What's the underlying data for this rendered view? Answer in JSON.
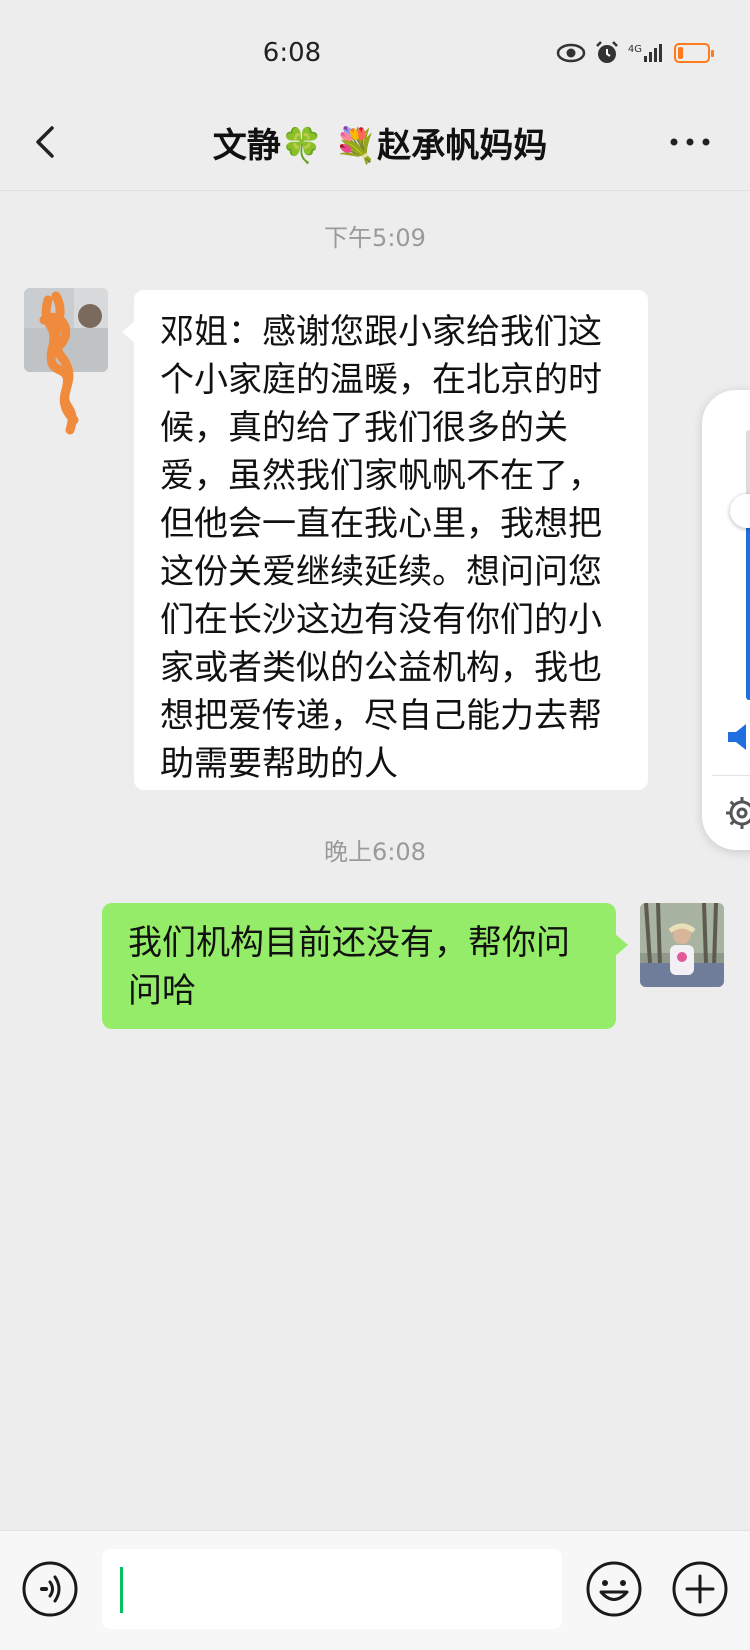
{
  "status_bar": {
    "time": "6:08",
    "network": "4G",
    "battery_level": 0.2,
    "colors": {
      "battery_low": "#ff7a1a"
    }
  },
  "header": {
    "title": "文静🍀 💐赵承帆妈妈",
    "back_icon": "chevron-left-icon",
    "more_icon": "more-dots-icon"
  },
  "messages": [
    {
      "timestamp": "下午5:09",
      "direction": "incoming",
      "lines": [
        "邓姐：感谢您跟小家给我们这",
        "个小家庭的温暖，在北京的时",
        "候，真的给了我们很多的关",
        "爱，虽然我们家帆帆不在了，",
        "但他会一直在我心里，我想把",
        "这份关爱继续延续。想问问您",
        "们在长沙这边有没有你们的小",
        "家或者类似的公益机构，我也",
        "想把爱传递，尽自己能力去帮",
        "助需要帮助的人"
      ]
    },
    {
      "timestamp": "晚上6:08",
      "direction": "outgoing",
      "lines": [
        "我们机构目前还没有，帮你问",
        "问哈"
      ]
    }
  ],
  "volume_panel": {
    "level": 0.7,
    "icons": [
      "speaker-icon",
      "settings-gear-icon"
    ],
    "colors": {
      "accent": "#1f6fe0"
    }
  },
  "input_bar": {
    "text": "",
    "icons": [
      "voice-icon",
      "emoji-icon",
      "plus-icon"
    ]
  },
  "colors": {
    "background": "#ededed",
    "outgoing_bubble": "#95ec69",
    "incoming_bubble": "#ffffff",
    "caret": "#07c160"
  }
}
